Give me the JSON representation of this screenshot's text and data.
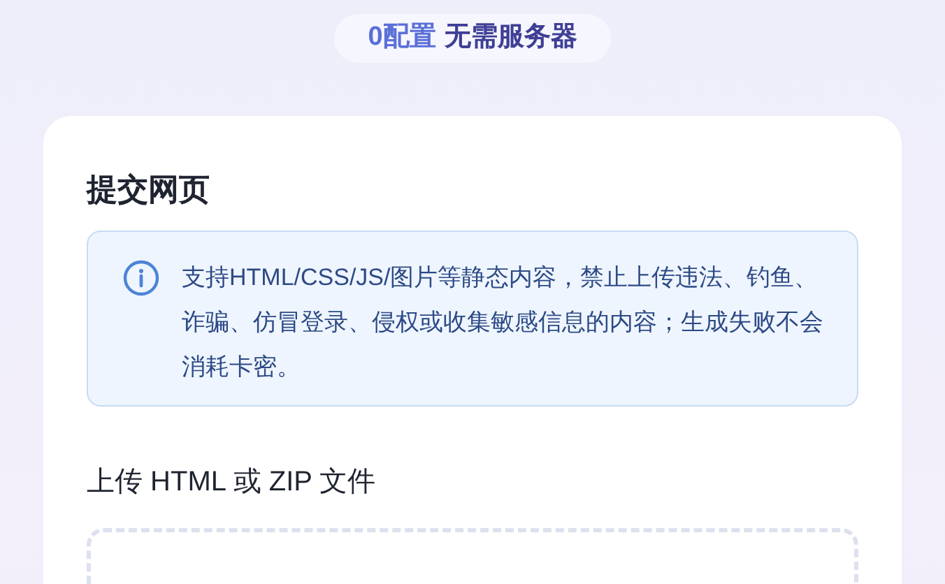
{
  "badge": {
    "highlight": "0配置",
    "text": "无需服务器"
  },
  "card": {
    "title": "提交网页",
    "notice": "支持HTML/CSS/JS/图片等静态内容，禁止上传违法、钓鱼、诈骗、仿冒登录、侵权或收集敏感信息的内容；生成失败不会消耗卡密。",
    "upload_label": "上传 HTML 或 ZIP 文件"
  }
}
